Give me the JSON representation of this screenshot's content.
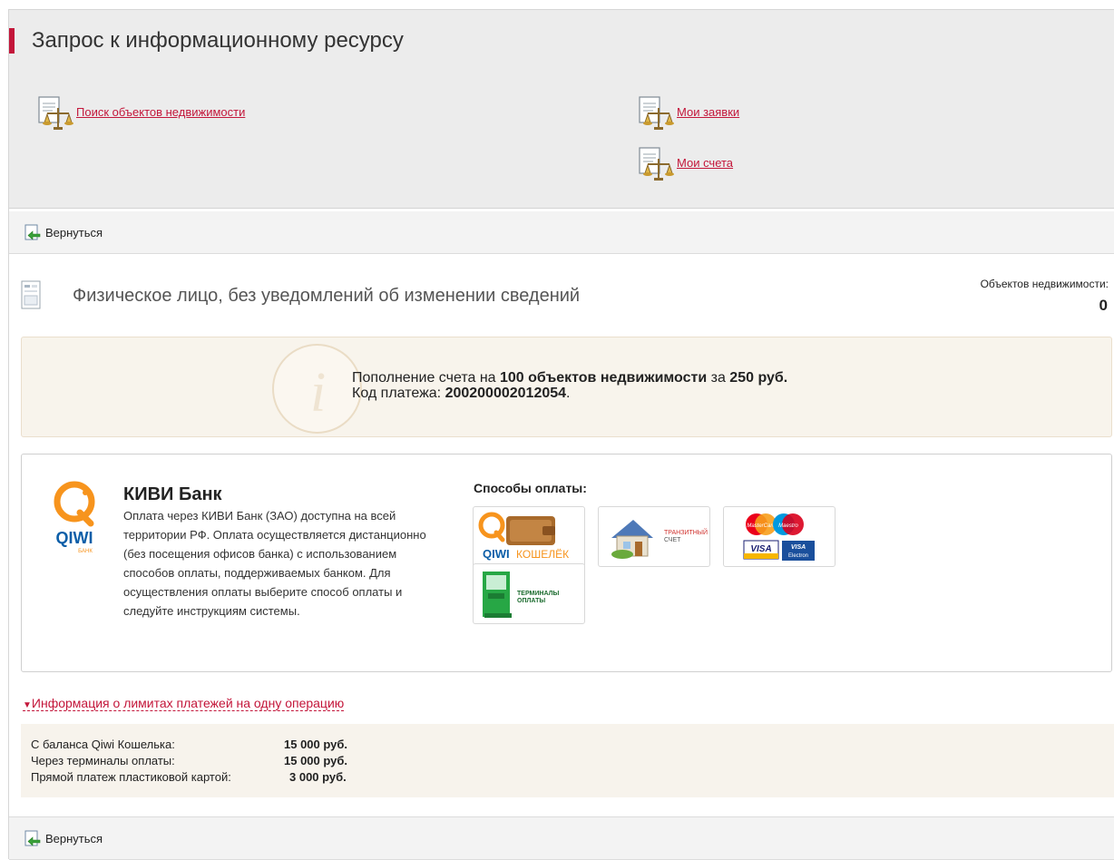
{
  "page_title": "Запрос к информационному ресурсу",
  "nav_links": {
    "search": "Поиск объектов недвижимости",
    "requests": "Мои заявки",
    "accounts": "Мои счета"
  },
  "back_label": "Вернуться",
  "section_title": "Физическое лицо, без уведомлений об изменении сведений",
  "objects_count": {
    "label": "Объектов недвижимости:",
    "value": "0"
  },
  "info": {
    "prefix": "Пополнение счета на ",
    "objects": "100 объектов недвижимости",
    "middle": " за ",
    "price": "250 руб.",
    "end_dot": ".",
    "code_label": "Код платежа: ",
    "code": "200200002012054",
    "code_end": "."
  },
  "bank": {
    "name": "КИВИ Банк",
    "description": "Оплата через КИВИ Банк (ЗАО) доступна на всей территории РФ. Оплата осуществляется дистанционно (без посещения офисов банка) с использованием способов оплаты, поддерживаемых банком. Для осуществления оплаты выберите способ оплаты и следуйте инструкциям системы.",
    "logo_text": "QIWI",
    "logo_subtext": "БАНК"
  },
  "payment_methods": {
    "title": "Способы оплаты:",
    "wallet": {
      "brand": "QIWI",
      "label": "КОШЕЛЁК"
    },
    "transit": {
      "line1": "ТРАНЗИТНЫЙ",
      "line2": "СЧЕТ"
    },
    "cards": {
      "mastercard": "MasterCard",
      "maestro": "Maestro",
      "visa": "VISA",
      "visa_electron": "VISA",
      "electron": "Electron"
    },
    "terminals": {
      "line1": "ТЕРМИНАЛЫ",
      "line2": "ОПЛАТЫ"
    }
  },
  "limits": {
    "toggle_label": "Информация о лимитах платежей на одну операцию",
    "rows": [
      {
        "label": "С баланса Qiwi Кошелька:",
        "value": "15 000 руб."
      },
      {
        "label": "Через терминалы оплаты:",
        "value": "15 000 руб."
      },
      {
        "label": "Прямой платеж пластиковой картой:",
        "value": "3 000 руб."
      }
    ]
  },
  "colors": {
    "accent": "#c3163a",
    "qiwi_orange": "#f7941d",
    "qiwi_blue": "#0b5ea8"
  }
}
